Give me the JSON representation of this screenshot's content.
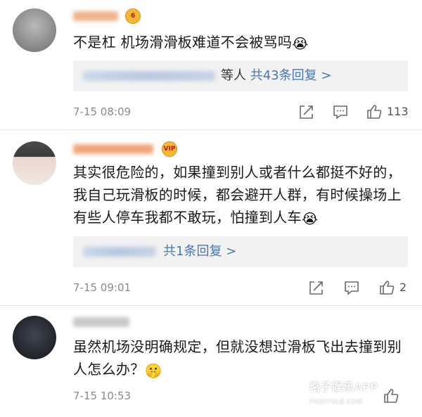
{
  "comments": [
    {
      "badge": "6",
      "text": "不是杠 机场滑滑板难道不会被骂吗",
      "emoji": "😭",
      "replies_suffix": "等人",
      "replies_link": "共43条回复 >",
      "time": "7-15 08:09",
      "likes": "113"
    },
    {
      "badge": "VIP",
      "text": "其实很危险的，如果撞到别人或者什么都挺不好的，我自己玩滑板的时候，都会避开人群，有时候操场上有些人停车我都不敢玩，怕撞到人车",
      "emoji": "😭",
      "replies_link": "共1条回复 >",
      "time": "7-15 09:01",
      "likes": "2"
    },
    {
      "text": "虽然机场没明确规定，但就没想过滑板飞出去撞到别人怎么办？",
      "emoji": "🤫",
      "time": "7-15 10:53"
    }
  ],
  "watermark": {
    "main": "略子娱乐APP",
    "sub": "PAIZIYULE.COM"
  },
  "icons": [
    "share-icon",
    "comment-icon",
    "like-icon"
  ]
}
